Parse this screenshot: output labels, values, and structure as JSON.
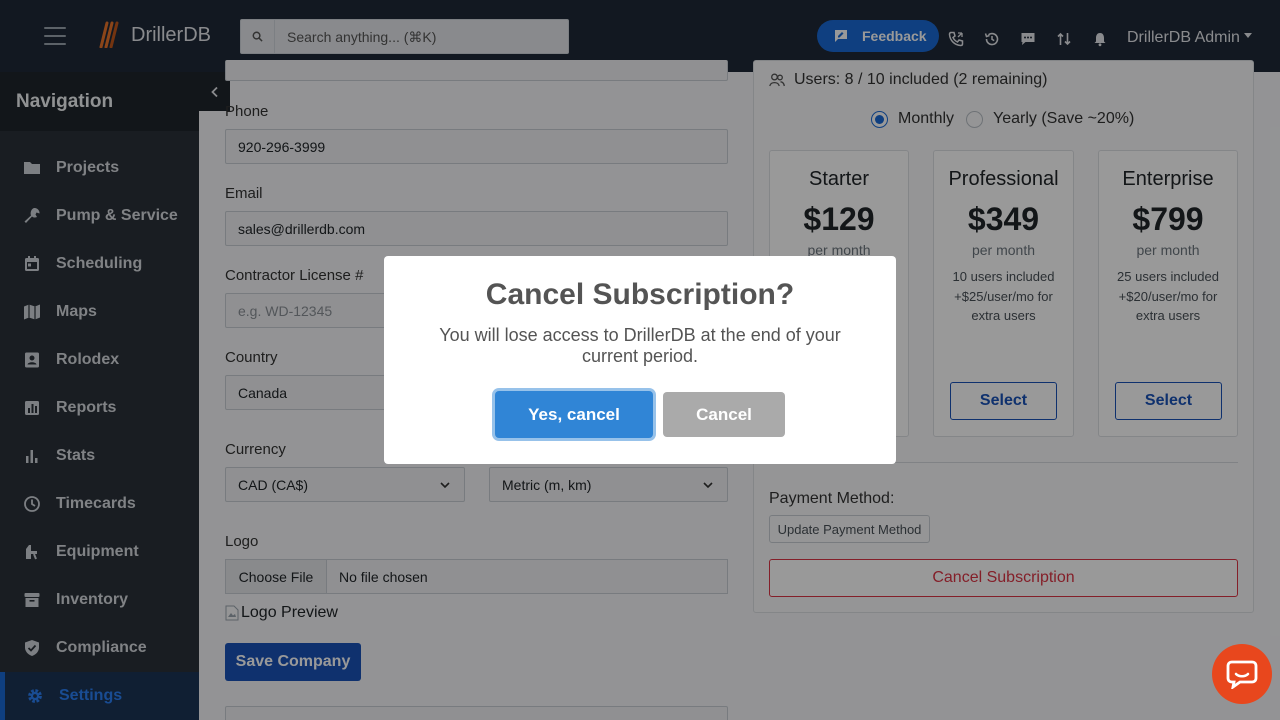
{
  "app": {
    "brand": "DrillerDB"
  },
  "search": {
    "placeholder": "Search anything... (⌘K)"
  },
  "topbar": {
    "feedback_label": "Feedback",
    "user_menu": "DrillerDB Admin"
  },
  "sidebar": {
    "title": "Navigation",
    "items": [
      {
        "label": "Projects",
        "icon": "folder-icon"
      },
      {
        "label": "Pump & Service",
        "icon": "wrench-icon"
      },
      {
        "label": "Scheduling",
        "icon": "calendar-icon"
      },
      {
        "label": "Maps",
        "icon": "map-icon"
      },
      {
        "label": "Rolodex",
        "icon": "contact-card-icon"
      },
      {
        "label": "Reports",
        "icon": "report-icon"
      },
      {
        "label": "Stats",
        "icon": "bar-chart-icon"
      },
      {
        "label": "Timecards",
        "icon": "clock-icon"
      },
      {
        "label": "Equipment",
        "icon": "drill-rig-icon"
      },
      {
        "label": "Inventory",
        "icon": "archive-box-icon"
      },
      {
        "label": "Compliance",
        "icon": "shield-check-icon"
      },
      {
        "label": "Settings",
        "icon": "gear-icon",
        "active": true
      }
    ]
  },
  "company_form": {
    "phone_label": "Phone",
    "phone_value": "920-296-3999",
    "email_label": "Email",
    "email_value": "sales@drillerdb.com",
    "license_label": "Contractor License #",
    "license_placeholder": "e.g. WD-12345",
    "country_label": "Country",
    "country_value": "Canada",
    "currency_label": "Currency",
    "currency_value": "CAD (CA$)",
    "units_value": "Metric (m, km)",
    "logo_label": "Logo",
    "file_button": "Choose File",
    "file_status": "No file chosen",
    "logo_preview_alt": "Logo Preview",
    "save_label": "Save Company"
  },
  "subscription": {
    "users_text": "Users: 8 / 10 included (2 remaining)",
    "billing": {
      "monthly": "Monthly",
      "yearly": "Yearly (Save ~20%)",
      "selected": "monthly"
    },
    "plans": [
      {
        "name": "Starter",
        "price": "$129",
        "per": "per month",
        "desc": "",
        "select_label": ""
      },
      {
        "name": "Professional",
        "price": "$349",
        "per": "per month",
        "desc": "10 users included +$25/user/mo for extra users",
        "select_label": "Select"
      },
      {
        "name": "Enterprise",
        "price": "$799",
        "per": "per month",
        "desc": "25 users included +$20/user/mo for extra users",
        "select_label": "Select"
      }
    ],
    "payment_label": "Payment Method:",
    "update_payment": "Update Payment Method",
    "cancel_subscription": "Cancel Subscription"
  },
  "modal": {
    "title": "Cancel Subscription?",
    "text": "You will lose access to DrillerDB at the end of your current period.",
    "confirm_label": "Yes, cancel",
    "cancel_label": "Cancel"
  },
  "colors": {
    "topbar": "#1f2937",
    "sidebar": "#2a3139",
    "accent": "#1a6ad6",
    "confirm": "#3085d6",
    "danger": "#dc3545",
    "chat": "#e8471d"
  }
}
